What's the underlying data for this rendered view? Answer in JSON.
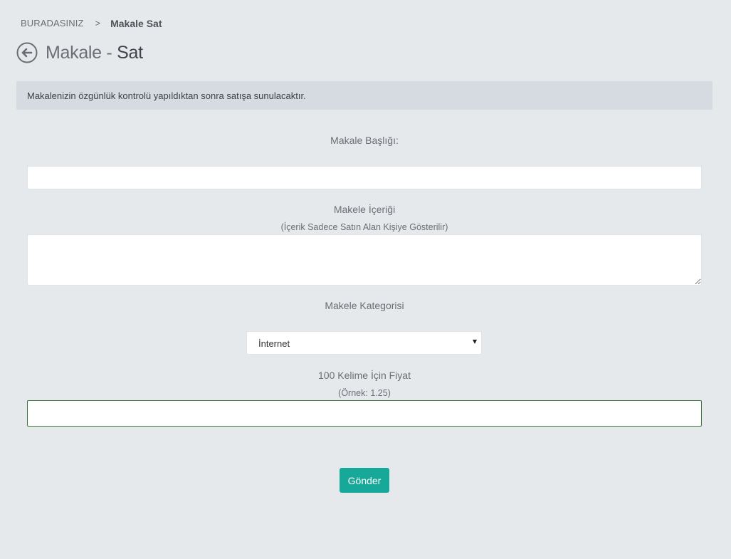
{
  "breadcrumb": {
    "root": "BURADASINIZ",
    "separator": ">",
    "current": "Makale Sat"
  },
  "header": {
    "title_light": "Makale - ",
    "title_strong": "Sat",
    "back_icon": "arrow-left-circle-icon"
  },
  "alert": {
    "text": "Makalenizin özgünlük kontrolü yapıldıktan sonra satışa sunulacaktır."
  },
  "form": {
    "title_field": {
      "label": "Makale Başlığı:",
      "value": ""
    },
    "content_field": {
      "label": "Makele İçeriği",
      "hint": "(İçerik Sadece Satın Alan Kişiye Gösterilir)",
      "value": ""
    },
    "category_field": {
      "label": "Makele Kategorisi",
      "selected": "İnternet",
      "arrow_icon": "caret-down-icon"
    },
    "price_field": {
      "label": "100 Kelime İçin Fiyat",
      "hint": "(Örnek: 1.25)",
      "value": ""
    },
    "submit_label": "Gönder"
  },
  "colors": {
    "background": "#e5e9ec",
    "alert_background": "#d5dbe0",
    "button": "#16a99a",
    "focus_border": "#3c7a3c"
  }
}
